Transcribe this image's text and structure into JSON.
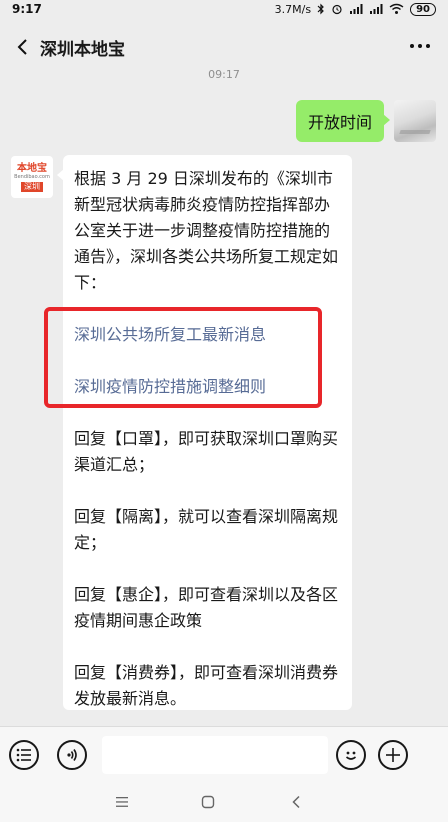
{
  "status_bar": {
    "time": "9:17",
    "net_speed": "3.7M/s",
    "battery": "90"
  },
  "header": {
    "title": "深圳本地宝"
  },
  "chat": {
    "timestamp": "09:17",
    "outgoing": {
      "text": "开放时间"
    },
    "bot_avatar": {
      "logo_top": "本地宝",
      "logo_sub": "Bendibao.com",
      "logo_city": "深圳"
    },
    "incoming": {
      "intro": "根据 3 月 29 日深圳发布的《深圳市新型冠状病毒肺炎疫情防控指挥部办公室关于进一步调整疫情防控措施的通告》，深圳各类公共场所复工规定如下：",
      "link1": "深圳公共场所复工最新消息",
      "link2": "深圳疫情防控措施调整细则",
      "reply1": "回复【口罩】，即可获取深圳口罩购买渠道汇总；",
      "reply2": "回复【隔离】，就可以查看深圳隔离规定；",
      "reply3": "回复【惠企】，即可查看深圳以及各区疫情期间惠企政策",
      "reply4": "回复【消费券】，即可查看深圳消费券发放最新消息。"
    }
  },
  "colors": {
    "outgoing_bubble": "#95ec69",
    "link": "#576b95",
    "highlight": "#e8262a"
  }
}
